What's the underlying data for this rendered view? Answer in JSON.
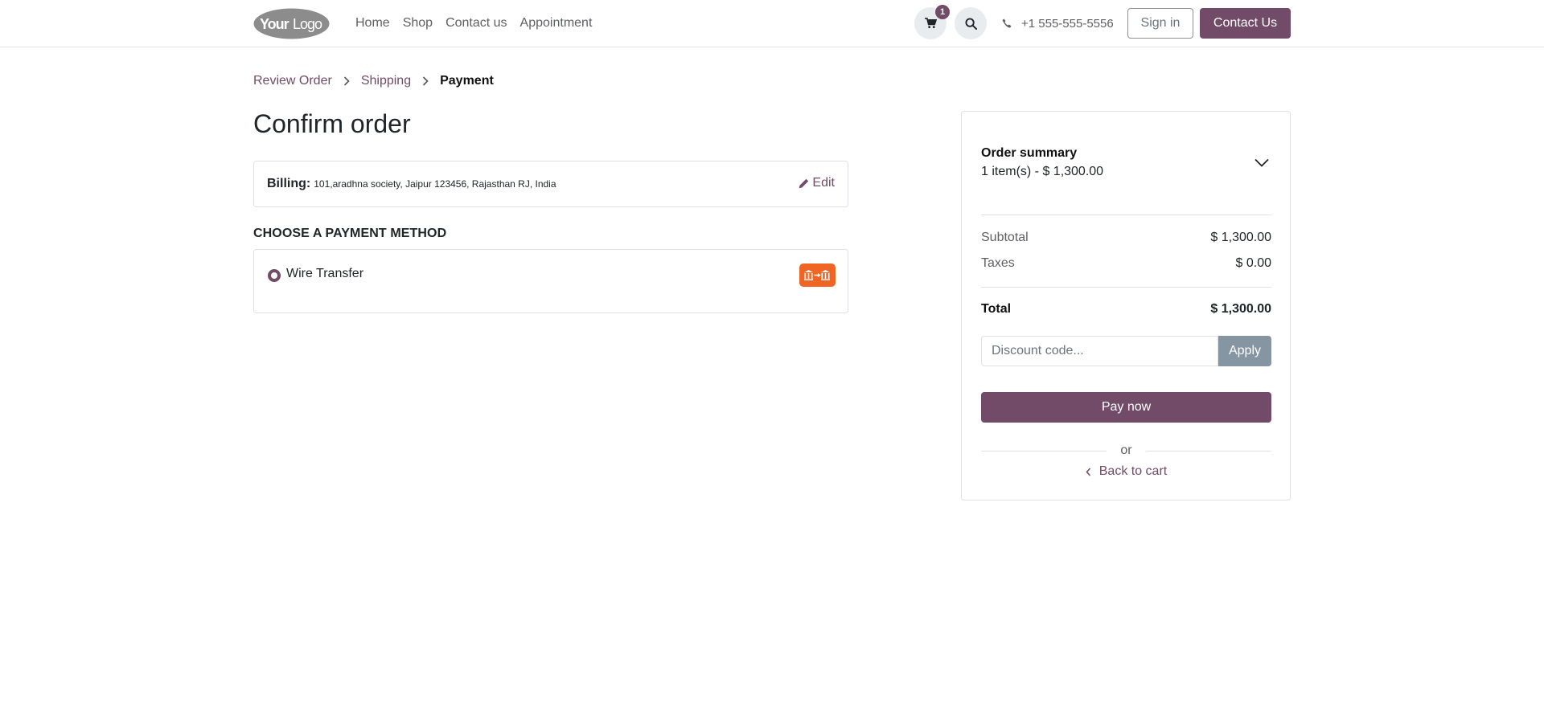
{
  "header": {
    "logo_text": "YourLogo",
    "nav": [
      "Home",
      "Shop",
      "Contact us",
      "Appointment"
    ],
    "cart_count": "1",
    "phone": "+1 555-555-5556",
    "signin_label": "Sign in",
    "contact_label": "Contact Us"
  },
  "breadcrumb": {
    "step1": "Review Order",
    "step2": "Shipping",
    "step3": "Payment"
  },
  "page_title": "Confirm order",
  "billing": {
    "label": "Billing:",
    "address": "101,aradhna society, Jaipur 123456, Rajasthan RJ, India",
    "edit_label": "Edit"
  },
  "payment": {
    "heading": "CHOOSE A PAYMENT METHOD",
    "method_name": "Wire Transfer"
  },
  "summary": {
    "title": "Order summary",
    "items_text": "1 item(s) -  $ 1,300.00",
    "subtotal_label": "Subtotal",
    "subtotal_value": "$ 1,300.00",
    "taxes_label": "Taxes",
    "taxes_value": "$ 0.00",
    "total_label": "Total",
    "total_value": "$ 1,300.00",
    "discount_placeholder": "Discount code...",
    "apply_label": "Apply",
    "pay_label": "Pay now",
    "or_text": "or",
    "back_label": "Back to cart"
  },
  "colors": {
    "brand": "#714b67",
    "payment_logo": "#f06424",
    "apply_button": "#8595a2"
  }
}
